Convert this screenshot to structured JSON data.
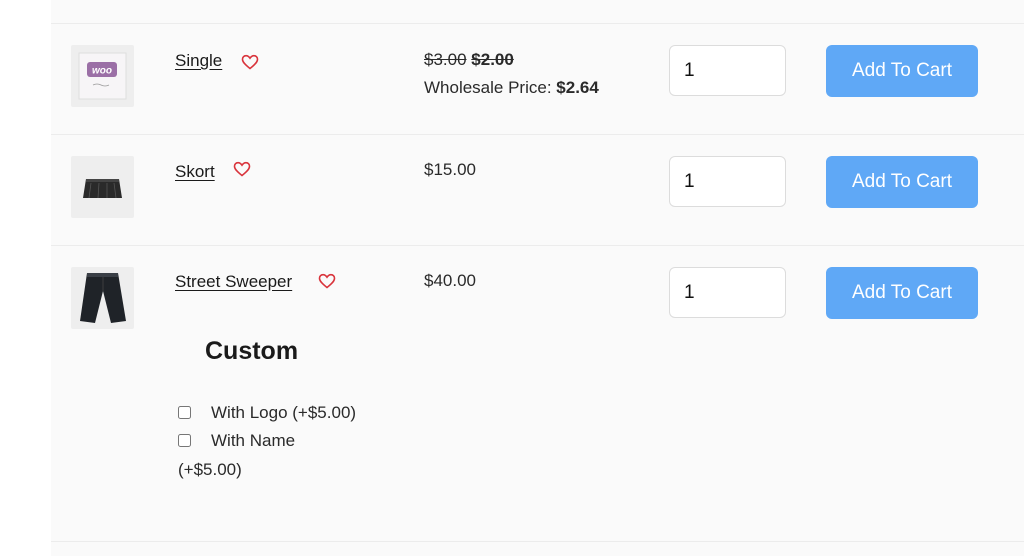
{
  "products": [
    {
      "name": "Single",
      "thumb_icon": "woo-logo-thumbnail",
      "price_original": "$3.00",
      "price_sale": "$2.00",
      "wholesale_label": "Wholesale Price:",
      "wholesale_value": "$2.64",
      "qty": "1",
      "button": "Add To Cart"
    },
    {
      "name": "Skort",
      "thumb_icon": "skort-thumbnail",
      "price": "$15.00",
      "qty": "1",
      "button": "Add To Cart"
    },
    {
      "name": "Street Sweeper",
      "thumb_icon": "shorts-thumbnail",
      "price": "$40.00",
      "qty": "1",
      "button": "Add To Cart",
      "addon_title": "Custom",
      "addons": [
        {
          "label": "With Logo (+$5.00)"
        },
        {
          "label": "With Name",
          "label_cont": "(+$5.00)"
        }
      ]
    }
  ],
  "colors": {
    "button": "#5fa8f6",
    "heart": "#d9343c",
    "row_bg": "#fafafa"
  }
}
